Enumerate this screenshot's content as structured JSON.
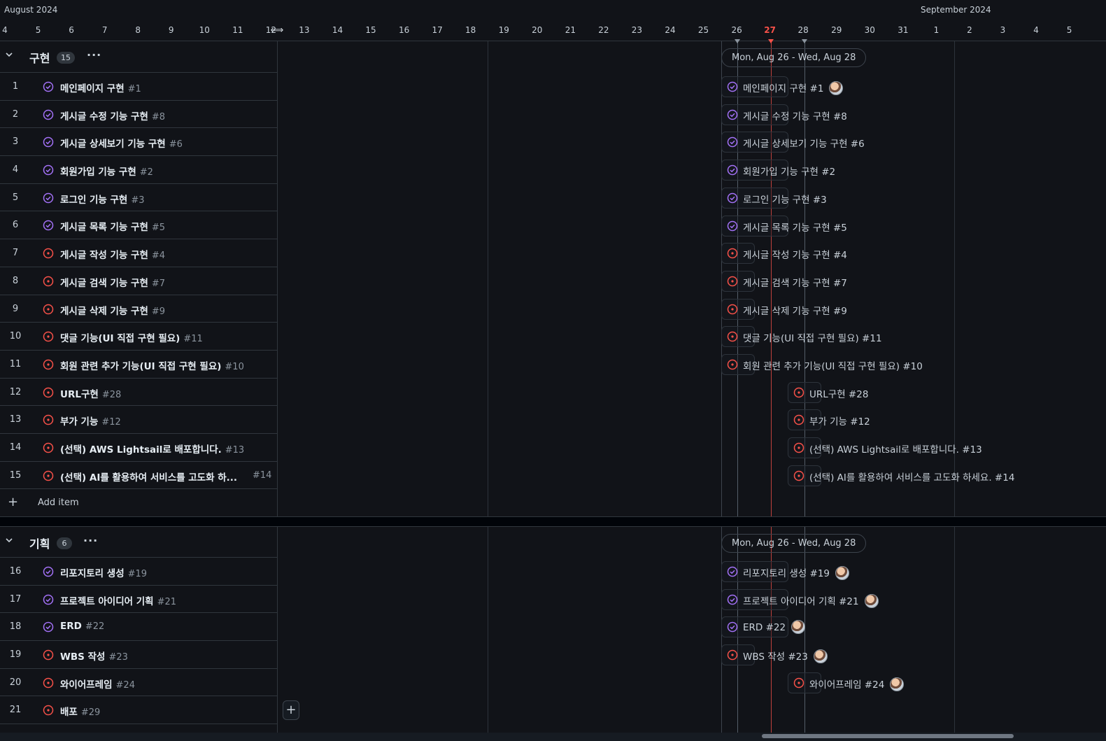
{
  "header": {
    "months": [
      {
        "label": "August 2024"
      },
      {
        "label": "September 2024"
      }
    ],
    "days": [
      "4",
      "5",
      "6",
      "7",
      "8",
      "9",
      "10",
      "11",
      "12",
      "13",
      "14",
      "15",
      "16",
      "17",
      "18",
      "19",
      "20",
      "21",
      "22",
      "23",
      "24",
      "25",
      "26",
      "27",
      "28",
      "29",
      "30",
      "31",
      "1",
      "2",
      "3",
      "4",
      "5"
    ],
    "today": "27"
  },
  "colors": {
    "closed_purple": "#a371f7",
    "open_red": "#f85149",
    "today_line": "#f85149",
    "border": "#30363d",
    "background": "#111318"
  },
  "groups": [
    {
      "name": "구현",
      "count": "15",
      "menu": "···",
      "range_label": "Mon, Aug 26 - Wed, Aug 28",
      "add_label": "Add item",
      "items": [
        {
          "num": "1",
          "title": "메인페이지 구현",
          "issue": "#1",
          "status": "closed",
          "bar_label": "메인페이지 구현 #1",
          "start": "26",
          "avatar": true
        },
        {
          "num": "2",
          "title": "게시글 수정 기능 구현",
          "issue": "#8",
          "status": "closed",
          "bar_label": "게시글 수정 기능 구현 #8",
          "start": "26",
          "avatar": false
        },
        {
          "num": "3",
          "title": "게시글 상세보기 기능 구현",
          "issue": "#6",
          "status": "closed",
          "bar_label": "게시글 상세보기 기능 구현 #6",
          "start": "26",
          "avatar": false
        },
        {
          "num": "4",
          "title": "회원가입 기능 구현",
          "issue": "#2",
          "status": "closed",
          "bar_label": "회원가입 기능 구현 #2",
          "start": "26",
          "avatar": false
        },
        {
          "num": "5",
          "title": "로그인 기능 구현",
          "issue": "#3",
          "status": "closed",
          "bar_label": "로그인 기능 구현 #3",
          "start": "26",
          "avatar": false
        },
        {
          "num": "6",
          "title": "게시글 목록 기능 구현",
          "issue": "#5",
          "status": "closed",
          "bar_label": "게시글 목록 기능 구현 #5",
          "start": "26",
          "avatar": false
        },
        {
          "num": "7",
          "title": "게시글 작성 기능 구현",
          "issue": "#4",
          "status": "open",
          "bar_label": "게시글 작성 기능 구현 #4",
          "start": "26",
          "avatar": false
        },
        {
          "num": "8",
          "title": "게시글 검색 기능 구현",
          "issue": "#7",
          "status": "open",
          "bar_label": "게시글 검색 기능 구현 #7",
          "start": "26",
          "avatar": false
        },
        {
          "num": "9",
          "title": "게시글 삭제 기능 구현",
          "issue": "#9",
          "status": "open",
          "bar_label": "게시글 삭제 기능 구현 #9",
          "start": "26",
          "avatar": false
        },
        {
          "num": "10",
          "title": "댓글 기능(UI 직접 구현 필요)",
          "issue": "#11",
          "status": "open",
          "bar_label": "댓글 기능(UI 직접 구현 필요) #11",
          "start": "26",
          "avatar": false
        },
        {
          "num": "11",
          "title": "회원 관련 추가 기능(UI 직접 구현 필요)",
          "issue": "#10",
          "status": "open",
          "bar_label": "회원 관련 추가 기능(UI 직접 구현 필요) #10",
          "start": "26",
          "avatar": false
        },
        {
          "num": "12",
          "title": "URL구현",
          "issue": "#28",
          "status": "open",
          "bar_label": "URL구현 #28",
          "start": "28",
          "avatar": false
        },
        {
          "num": "13",
          "title": "부가 기능",
          "issue": "#12",
          "status": "open",
          "bar_label": "부가 기능 #12",
          "start": "28",
          "avatar": false
        },
        {
          "num": "14",
          "title": "(선택) AWS Lightsail로 배포합니다.",
          "issue": "#13",
          "status": "open",
          "bar_label": "(선택) AWS Lightsail로 배포합니다. #13",
          "start": "28",
          "avatar": false
        },
        {
          "num": "15",
          "title": "(선택) AI를 활용하여 서비스를 고도화 하...",
          "issue": "#14",
          "status": "open",
          "bar_label": "(선택) AI를 활용하여 서비스를 고도화 하세요. #14",
          "start": "28",
          "avatar": false,
          "truncated": true
        }
      ]
    },
    {
      "name": "기획",
      "count": "6",
      "menu": "···",
      "range_label": "Mon, Aug 26 - Wed, Aug 28",
      "items": [
        {
          "num": "16",
          "title": "리포지토리 생성",
          "issue": "#19",
          "status": "closed",
          "bar_label": "리포지토리 생성 #19",
          "start": "26",
          "avatar": true
        },
        {
          "num": "17",
          "title": "프로젝트 아이디어 기획",
          "issue": "#21",
          "status": "closed",
          "bar_label": "프로젝트 아이디어 기획 #21",
          "start": "26",
          "avatar": true
        },
        {
          "num": "18",
          "title": "ERD",
          "issue": "#22",
          "status": "closed",
          "bar_label": "ERD #22",
          "start": "26",
          "avatar": true
        },
        {
          "num": "19",
          "title": "WBS 작성",
          "issue": "#23",
          "status": "open",
          "bar_label": "WBS 작성 #23",
          "start": "26",
          "avatar": true
        },
        {
          "num": "20",
          "title": "와이어프레임",
          "issue": "#24",
          "status": "open",
          "bar_label": "와이어프레임 #24",
          "start": "28",
          "avatar": true
        },
        {
          "num": "21",
          "title": "배포",
          "issue": "#29",
          "status": "open",
          "bar_label": "",
          "start": "",
          "avatar": false
        }
      ]
    }
  ],
  "add_button": "+"
}
